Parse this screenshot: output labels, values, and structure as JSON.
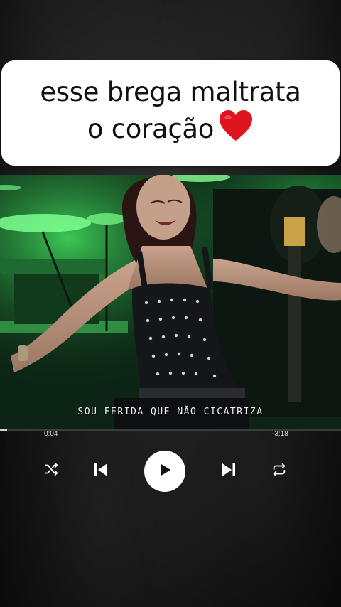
{
  "caption": {
    "line1": "esse brega maltrata",
    "line2": "o coração",
    "emoji": "heart-icon"
  },
  "video": {
    "lyric": "SOU FERIDA QUE NÃO CICATRIZA"
  },
  "player": {
    "elapsed": "0:04",
    "remaining": "-3:18",
    "progress": 0.02,
    "buttons": {
      "shuffle": "shuffle-icon",
      "previous": "skip-previous-icon",
      "play": "play-icon",
      "next": "skip-next-icon",
      "repeat": "repeat-icon"
    }
  },
  "colors": {
    "stage_green": "#2fd04a",
    "card_bg": "#ffffff",
    "heart": "#e0141e"
  }
}
